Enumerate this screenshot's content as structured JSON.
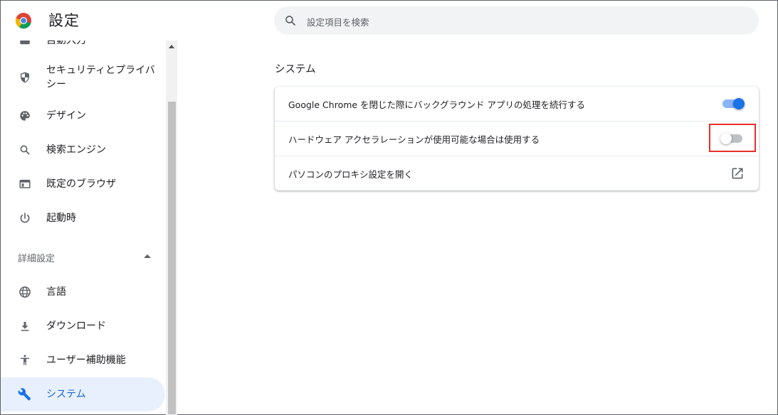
{
  "header": {
    "title": "設定",
    "search_placeholder": "設定項目を検索"
  },
  "sidebar": {
    "items": [
      {
        "label": "自動入力",
        "icon": "autofill-icon"
      },
      {
        "label": "セキュリティとプライバシー",
        "label_line1": "セキュリティとプライバ",
        "label_line2": "シー",
        "icon": "shield-icon"
      },
      {
        "label": "デザイン",
        "icon": "palette-icon"
      },
      {
        "label": "検索エンジン",
        "icon": "search-icon"
      },
      {
        "label": "既定のブラウザ",
        "icon": "browser-icon"
      },
      {
        "label": "起動時",
        "icon": "power-icon"
      },
      {
        "label": "言語",
        "icon": "globe-icon"
      },
      {
        "label": "ダウンロード",
        "icon": "download-icon"
      },
      {
        "label": "ユーザー補助機能",
        "icon": "accessibility-icon"
      },
      {
        "label": "システム",
        "icon": "wrench-icon"
      }
    ],
    "advanced_label": "詳細設定"
  },
  "main": {
    "section_title": "システム",
    "rows": [
      {
        "label": "Google Chrome を閉じた際にバックグラウンド アプリの処理を続行する",
        "control": "toggle",
        "state": "on"
      },
      {
        "label": "ハードウェア アクセラレーションが使用可能な場合は使用する",
        "control": "toggle",
        "state": "off"
      },
      {
        "label": "パソコンのプロキシ設定を開く",
        "control": "external-link"
      }
    ]
  },
  "colors": {
    "accent": "#1a73e8",
    "active_bg": "#e8f0fe",
    "highlight": "#e5302a"
  }
}
